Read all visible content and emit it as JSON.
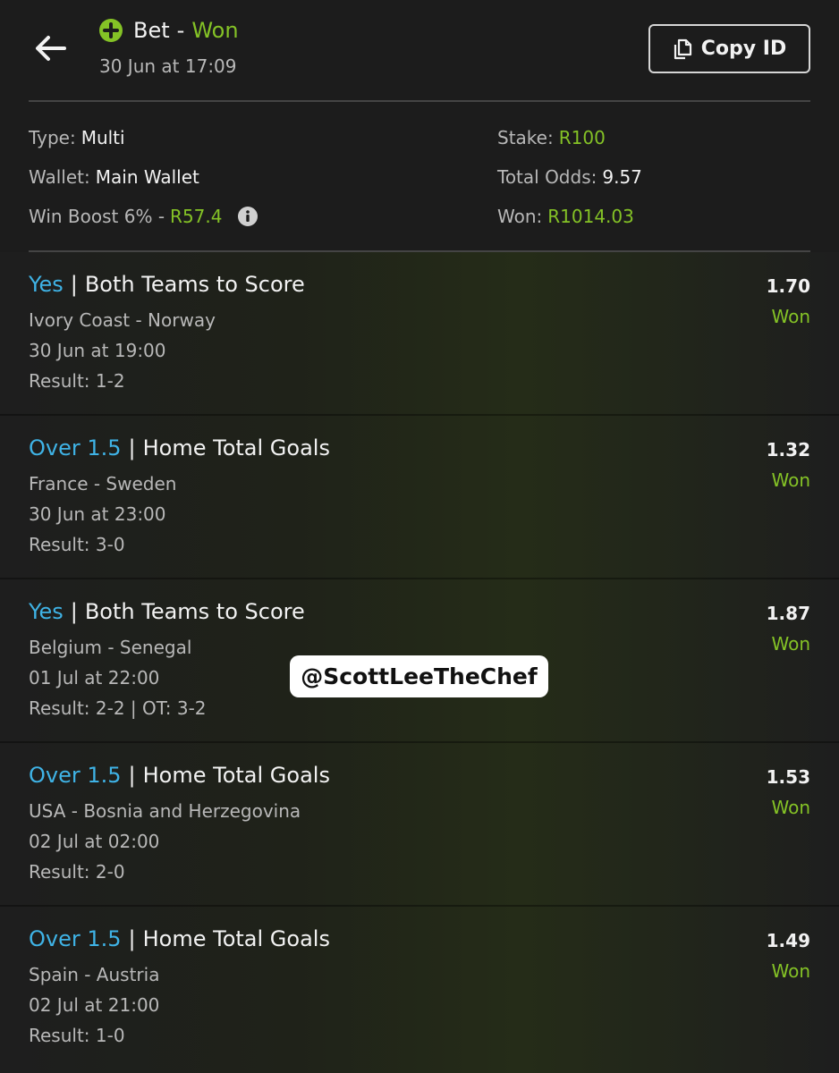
{
  "header": {
    "title_bet": "Bet",
    "title_sep": "-",
    "title_status": "Won",
    "datetime": "30 Jun at 17:09",
    "copy_label": "Copy ID"
  },
  "summary": {
    "type_label": "Type:",
    "type_value": "Multi",
    "wallet_label": "Wallet:",
    "wallet_value": "Main Wallet",
    "boost_label": "Win Boost 6% -",
    "boost_value": "R57.4",
    "stake_label": "Stake:",
    "stake_value": "R100",
    "odds_label": "Total Odds:",
    "odds_value": "9.57",
    "won_label": "Won:",
    "won_value": "R1014.03"
  },
  "legs": [
    {
      "pick": "Yes",
      "market": "Both Teams to Score",
      "match": "Ivory Coast - Norway",
      "date": "30 Jun at 19:00",
      "result": "Result: 1-2",
      "odds": "1.70",
      "status": "Won"
    },
    {
      "pick": "Over 1.5",
      "market": "Home Total Goals",
      "match": "France - Sweden",
      "date": "30 Jun at 23:00",
      "result": "Result: 3-0",
      "odds": "1.32",
      "status": "Won"
    },
    {
      "pick": "Yes",
      "market": "Both Teams to Score",
      "match": "Belgium - Senegal",
      "date": "01 Jul at 22:00",
      "result": "Result: 2-2 | OT: 3-2",
      "odds": "1.87",
      "status": "Won"
    },
    {
      "pick": "Over 1.5",
      "market": "Home Total Goals",
      "match": "USA - Bosnia and Herzegovina",
      "date": "02 Jul at 02:00",
      "result": "Result: 2-0",
      "odds": "1.53",
      "status": "Won"
    },
    {
      "pick": "Over 1.5",
      "market": "Home Total Goals",
      "match": "Spain - Austria",
      "date": "02 Jul at 21:00",
      "result": "Result: 1-0",
      "odds": "1.49",
      "status": "Won"
    }
  ],
  "watermark": "@ScottLeeTheChef",
  "icons": {
    "back": "arrow-left-icon",
    "status": "plus-circle-icon",
    "copy": "copy-icon",
    "info": "info-icon"
  },
  "colors": {
    "won_green": "#84c226",
    "pick_blue": "#3fb3e6",
    "background": "#1c1c1c"
  }
}
